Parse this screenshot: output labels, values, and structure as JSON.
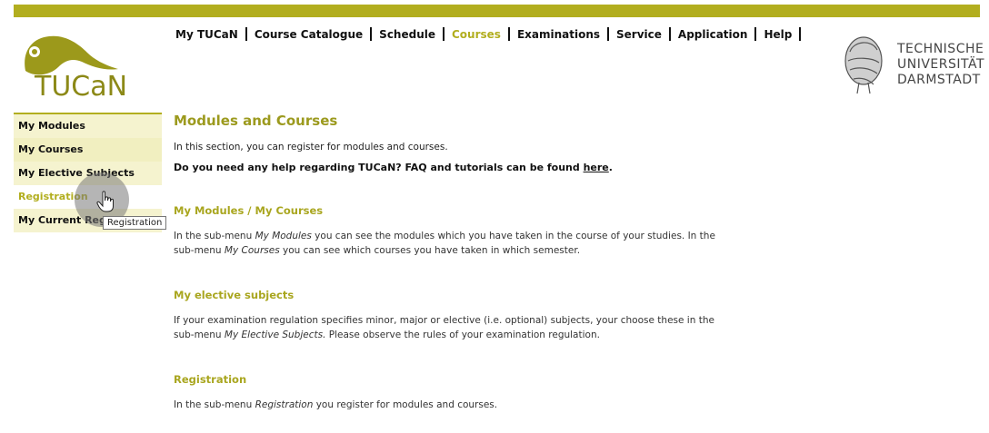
{
  "nav": {
    "items": [
      {
        "label": "My TUCaN",
        "active": false
      },
      {
        "label": "Course Catalogue",
        "active": false
      },
      {
        "label": "Schedule",
        "active": false
      },
      {
        "label": "Courses",
        "active": true
      },
      {
        "label": "Examinations",
        "active": false
      },
      {
        "label": "Service",
        "active": false
      },
      {
        "label": "Application",
        "active": false
      },
      {
        "label": "Help",
        "active": false
      }
    ]
  },
  "logo": {
    "text": "TUCaN"
  },
  "university": {
    "line1": "TECHNISCHE",
    "line2": "UNIVERSITÄT",
    "line3": "DARMSTADT"
  },
  "sidebar": {
    "items": [
      {
        "label": "My Modules"
      },
      {
        "label": "My Courses"
      },
      {
        "label": "My Elective Subjects"
      },
      {
        "label": "Registration"
      },
      {
        "label": "My Current Registrations"
      }
    ]
  },
  "tooltip": "Registration",
  "main": {
    "title": "Modules and Courses",
    "intro": "In this section, you can register for modules and courses.",
    "help_text": "Do you need any help regarding TUCaN? FAQ and tutorials can be found ",
    "help_link": "here",
    "help_end": ".",
    "sections": [
      {
        "title": "My Modules / My Courses",
        "t1": "In the sub-menu ",
        "i1": "My Modules",
        "t2": " you can see the modules which you have taken in the course of your studies. In the sub-menu ",
        "i2": "My Courses",
        "t3": " you can see which courses you have taken in which semester."
      },
      {
        "title": "My elective subjects",
        "t1": "If your examination regulation specifies minor, major or elective (i.e. optional) subjects, your choose these in the sub-menu ",
        "i1": "My Elective Subjects.",
        "t2": " Please observe the rules of your examination regulation."
      },
      {
        "title": "Registration",
        "t1": "In the sub-menu ",
        "i1": "Registration",
        "t2": " you register for modules and courses."
      }
    ]
  },
  "colors": {
    "accent": "#b2ae1f",
    "sidebar_bg": "#f1efc0"
  }
}
